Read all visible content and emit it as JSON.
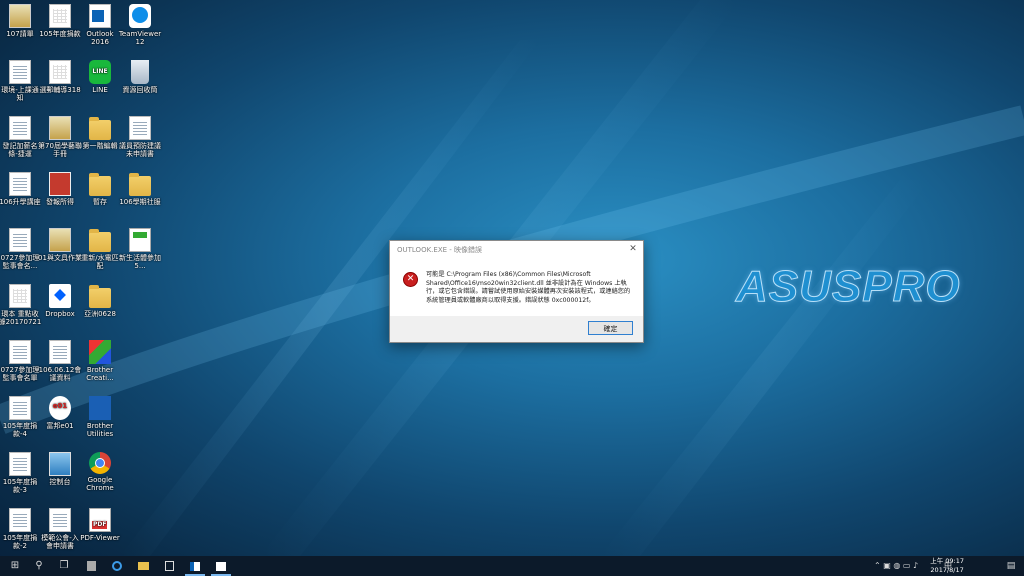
{
  "desktop": {
    "icons": [
      {
        "label": "107請單",
        "kind": "picture"
      },
      {
        "label": "105年度捐款",
        "kind": "excel"
      },
      {
        "label": "Outlook 2016",
        "kind": "outlook"
      },
      {
        "label": "TeamViewer 12",
        "kind": "teamviewer"
      },
      {
        "label": "環境-上課通知",
        "kind": "doc"
      },
      {
        "label": "選郵輔導318",
        "kind": "excel"
      },
      {
        "label": "LINE",
        "kind": "line"
      },
      {
        "label": "資源回收筒",
        "kind": "recycle"
      },
      {
        "label": "發記加薪名條-捷運",
        "kind": "doc"
      },
      {
        "label": "第70屆學藝聯手冊",
        "kind": "picture"
      },
      {
        "label": "第一階編輯",
        "kind": "folder"
      },
      {
        "label": "議員預防建議未申請書",
        "kind": "doc"
      },
      {
        "label": "106升學講座",
        "kind": "doc"
      },
      {
        "label": "發報所得",
        "kind": "red"
      },
      {
        "label": "暫存",
        "kind": "folder"
      },
      {
        "label": "106學期社服",
        "kind": "folder"
      },
      {
        "label": "0727參加理監事會名...",
        "kind": "doc"
      },
      {
        "label": "01與文具作業",
        "kind": "picture"
      },
      {
        "label": "重新/水電匹配",
        "kind": "folder"
      },
      {
        "label": "新生活體參加5...",
        "kind": "cap"
      },
      {
        "label": "環本 重點收據20170721",
        "kind": "excel"
      },
      {
        "label": "Dropbox",
        "kind": "dropbox"
      },
      {
        "label": "亞洲0628",
        "kind": "folder"
      },
      {
        "label": "0727參加理監事會名單",
        "kind": "doc"
      },
      {
        "label": "106.06.12會議資料",
        "kind": "doc"
      },
      {
        "label": "Brother Creati...",
        "kind": "brother"
      },
      {
        "label": "105年度捐款-4",
        "kind": "doc"
      },
      {
        "label": "富邦e01",
        "kind": "e01"
      },
      {
        "label": "Brother Utilities",
        "kind": "bu"
      },
      {
        "label": "105年度捐款-3",
        "kind": "doc"
      },
      {
        "label": "控制台",
        "kind": "control"
      },
      {
        "label": "Google Chrome",
        "kind": "chrome"
      },
      {
        "label": "105年度捐款-2",
        "kind": "doc"
      },
      {
        "label": "模範公會-入會申請書",
        "kind": "doc"
      },
      {
        "label": "PDF-Viewer",
        "kind": "pdf"
      }
    ]
  },
  "brand_logo": "ASUSPRO",
  "dialog": {
    "title": "OUTLOOK.EXE - 映像錯誤",
    "message": "可能是 C:\\Program Files (x86)\\Common Files\\Microsoft Shared\\Office16\\mso20win32client.dll 並非設計為在 Windows 上執行，或它包含錯誤。請嘗試使用原始安裝媒體再次安裝該程式，或連絡您的系統管理員或軟體廠商以取得支援。錯誤狀態 0xc000012f。",
    "ok_label": "確定",
    "close_glyph": "✕",
    "error_glyph": "✕"
  },
  "taskbar": {
    "start_glyph": "⊞",
    "search_glyph": "⚲",
    "taskview_glyph": "❐",
    "tray_glyphs": "⌃ ▣ ◍ ▭ ♪",
    "ime": "中",
    "time": "上午 09:17",
    "date": "2017/8/17",
    "notification_glyph": "▤"
  },
  "colors": {
    "accent": "#2f7fd0",
    "error": "#c81f1f",
    "logo": "#1f8fd0"
  }
}
